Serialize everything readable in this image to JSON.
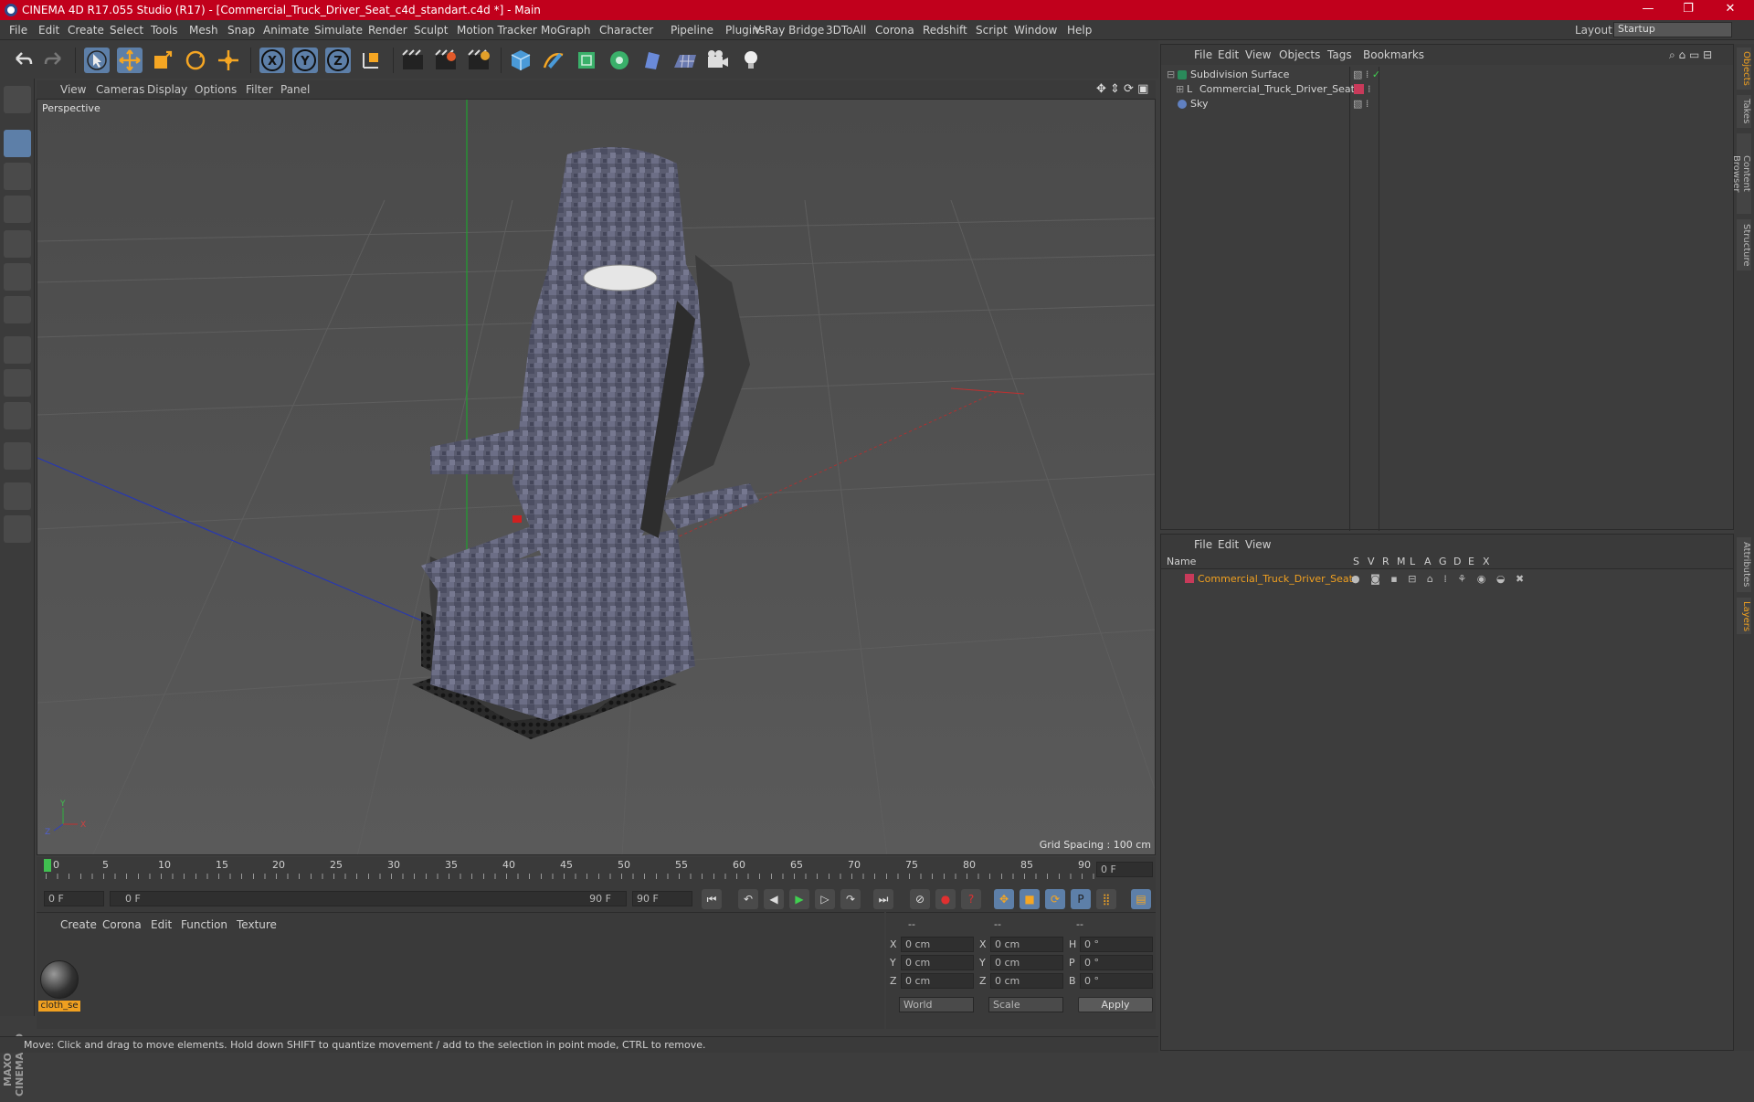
{
  "window": {
    "title": "CINEMA 4D R17.055 Studio (R17) - [Commercial_Truck_Driver_Seat_c4d_standart.c4d *] - Main",
    "minimize": "—",
    "maximize": "❐",
    "close": "✕"
  },
  "menubar": {
    "items": [
      "File",
      "Edit",
      "Create",
      "Select",
      "Tools",
      "Mesh",
      "Snap",
      "Animate",
      "Simulate",
      "Render",
      "Sculpt",
      "Motion Tracker",
      "MoGraph",
      "Character",
      "Pipeline",
      "Plugins",
      "V-Ray Bridge",
      "3DToAll",
      "Corona",
      "Redshift",
      "Script",
      "Window",
      "Help"
    ],
    "layout_label": "Layout:",
    "layout_value": "Startup"
  },
  "viewport": {
    "menu": [
      "View",
      "Cameras",
      "Display",
      "Options",
      "Filter",
      "Panel"
    ],
    "label": "Perspective",
    "grid_spacing": "Grid Spacing : 100 cm"
  },
  "timeline": {
    "ticks": [
      "0",
      "5",
      "10",
      "15",
      "20",
      "25",
      "30",
      "35",
      "40",
      "45",
      "50",
      "55",
      "60",
      "65",
      "70",
      "75",
      "80",
      "85",
      "90"
    ],
    "current_frame": "0 F"
  },
  "playback": {
    "start": "0 F",
    "range_start": "0 F",
    "range_end": "90 F",
    "end": "90 F"
  },
  "materials": {
    "menu": [
      "Create",
      "Corona",
      "Edit",
      "Function",
      "Texture"
    ],
    "items": [
      {
        "name": "cloth_se"
      }
    ]
  },
  "coords": {
    "header": [
      "--",
      "--",
      "--"
    ],
    "rows": [
      {
        "a": "X",
        "av": "0 cm",
        "b": "X",
        "bv": "0 cm",
        "c": "H",
        "cv": "0 °"
      },
      {
        "a": "Y",
        "av": "0 cm",
        "b": "Y",
        "bv": "0 cm",
        "c": "P",
        "cv": "0 °"
      },
      {
        "a": "Z",
        "av": "0 cm",
        "b": "Z",
        "bv": "0 cm",
        "c": "B",
        "cv": "0 °"
      }
    ],
    "world": "World",
    "scale": "Scale",
    "apply": "Apply"
  },
  "objects": {
    "menu": [
      "File",
      "Edit",
      "View",
      "Objects",
      "Tags",
      "Bookmarks"
    ],
    "items": [
      {
        "name": "Subdivision Surface",
        "color": "#2a8a5a"
      },
      {
        "name": "Commercial_Truck_Driver_Seat",
        "color": "#c83a5a"
      },
      {
        "name": "Sky",
        "color": "#6080c0"
      }
    ]
  },
  "layers": {
    "menu": [
      "File",
      "Edit",
      "View"
    ],
    "columns": [
      "Name",
      "S",
      "V",
      "R",
      "M",
      "L",
      "A",
      "G",
      "D",
      "E",
      "X"
    ],
    "items": [
      {
        "name": "Commercial_Truck_Driver_Seat",
        "color": "#c83a5a"
      }
    ]
  },
  "side_tabs": [
    "Objects",
    "Takes",
    "Content Browser",
    "Structure",
    "Attributes",
    "Layers"
  ],
  "status": "Move: Click and drag to move elements. Hold down SHIFT to quantize movement / add to the selection in point mode, CTRL to remove.",
  "axis_labels": {
    "x": "X",
    "y": "Y",
    "z": "Z"
  }
}
